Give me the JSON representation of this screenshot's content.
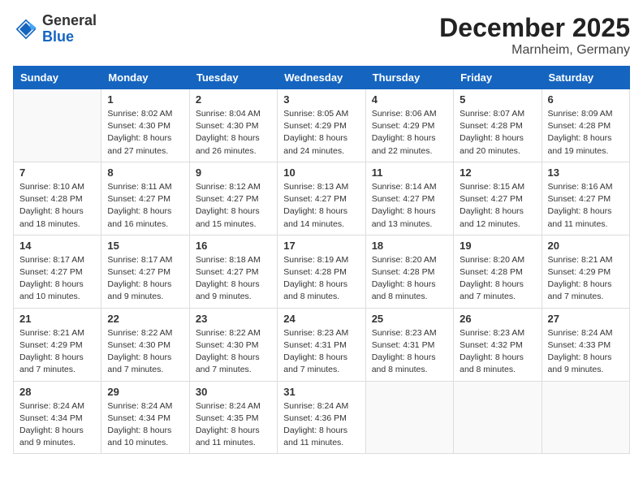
{
  "header": {
    "logo_general": "General",
    "logo_blue": "Blue",
    "month_year": "December 2025",
    "location": "Marnheim, Germany"
  },
  "days_of_week": [
    "Sunday",
    "Monday",
    "Tuesday",
    "Wednesday",
    "Thursday",
    "Friday",
    "Saturday"
  ],
  "weeks": [
    [
      {
        "day": "",
        "info": ""
      },
      {
        "day": "1",
        "info": "Sunrise: 8:02 AM\nSunset: 4:30 PM\nDaylight: 8 hours\nand 27 minutes."
      },
      {
        "day": "2",
        "info": "Sunrise: 8:04 AM\nSunset: 4:30 PM\nDaylight: 8 hours\nand 26 minutes."
      },
      {
        "day": "3",
        "info": "Sunrise: 8:05 AM\nSunset: 4:29 PM\nDaylight: 8 hours\nand 24 minutes."
      },
      {
        "day": "4",
        "info": "Sunrise: 8:06 AM\nSunset: 4:29 PM\nDaylight: 8 hours\nand 22 minutes."
      },
      {
        "day": "5",
        "info": "Sunrise: 8:07 AM\nSunset: 4:28 PM\nDaylight: 8 hours\nand 20 minutes."
      },
      {
        "day": "6",
        "info": "Sunrise: 8:09 AM\nSunset: 4:28 PM\nDaylight: 8 hours\nand 19 minutes."
      }
    ],
    [
      {
        "day": "7",
        "info": "Sunrise: 8:10 AM\nSunset: 4:28 PM\nDaylight: 8 hours\nand 18 minutes."
      },
      {
        "day": "8",
        "info": "Sunrise: 8:11 AM\nSunset: 4:27 PM\nDaylight: 8 hours\nand 16 minutes."
      },
      {
        "day": "9",
        "info": "Sunrise: 8:12 AM\nSunset: 4:27 PM\nDaylight: 8 hours\nand 15 minutes."
      },
      {
        "day": "10",
        "info": "Sunrise: 8:13 AM\nSunset: 4:27 PM\nDaylight: 8 hours\nand 14 minutes."
      },
      {
        "day": "11",
        "info": "Sunrise: 8:14 AM\nSunset: 4:27 PM\nDaylight: 8 hours\nand 13 minutes."
      },
      {
        "day": "12",
        "info": "Sunrise: 8:15 AM\nSunset: 4:27 PM\nDaylight: 8 hours\nand 12 minutes."
      },
      {
        "day": "13",
        "info": "Sunrise: 8:16 AM\nSunset: 4:27 PM\nDaylight: 8 hours\nand 11 minutes."
      }
    ],
    [
      {
        "day": "14",
        "info": "Sunrise: 8:17 AM\nSunset: 4:27 PM\nDaylight: 8 hours\nand 10 minutes."
      },
      {
        "day": "15",
        "info": "Sunrise: 8:17 AM\nSunset: 4:27 PM\nDaylight: 8 hours\nand 9 minutes."
      },
      {
        "day": "16",
        "info": "Sunrise: 8:18 AM\nSunset: 4:27 PM\nDaylight: 8 hours\nand 9 minutes."
      },
      {
        "day": "17",
        "info": "Sunrise: 8:19 AM\nSunset: 4:28 PM\nDaylight: 8 hours\nand 8 minutes."
      },
      {
        "day": "18",
        "info": "Sunrise: 8:20 AM\nSunset: 4:28 PM\nDaylight: 8 hours\nand 8 minutes."
      },
      {
        "day": "19",
        "info": "Sunrise: 8:20 AM\nSunset: 4:28 PM\nDaylight: 8 hours\nand 7 minutes."
      },
      {
        "day": "20",
        "info": "Sunrise: 8:21 AM\nSunset: 4:29 PM\nDaylight: 8 hours\nand 7 minutes."
      }
    ],
    [
      {
        "day": "21",
        "info": "Sunrise: 8:21 AM\nSunset: 4:29 PM\nDaylight: 8 hours\nand 7 minutes."
      },
      {
        "day": "22",
        "info": "Sunrise: 8:22 AM\nSunset: 4:30 PM\nDaylight: 8 hours\nand 7 minutes."
      },
      {
        "day": "23",
        "info": "Sunrise: 8:22 AM\nSunset: 4:30 PM\nDaylight: 8 hours\nand 7 minutes."
      },
      {
        "day": "24",
        "info": "Sunrise: 8:23 AM\nSunset: 4:31 PM\nDaylight: 8 hours\nand 7 minutes."
      },
      {
        "day": "25",
        "info": "Sunrise: 8:23 AM\nSunset: 4:31 PM\nDaylight: 8 hours\nand 8 minutes."
      },
      {
        "day": "26",
        "info": "Sunrise: 8:23 AM\nSunset: 4:32 PM\nDaylight: 8 hours\nand 8 minutes."
      },
      {
        "day": "27",
        "info": "Sunrise: 8:24 AM\nSunset: 4:33 PM\nDaylight: 8 hours\nand 9 minutes."
      }
    ],
    [
      {
        "day": "28",
        "info": "Sunrise: 8:24 AM\nSunset: 4:34 PM\nDaylight: 8 hours\nand 9 minutes."
      },
      {
        "day": "29",
        "info": "Sunrise: 8:24 AM\nSunset: 4:34 PM\nDaylight: 8 hours\nand 10 minutes."
      },
      {
        "day": "30",
        "info": "Sunrise: 8:24 AM\nSunset: 4:35 PM\nDaylight: 8 hours\nand 11 minutes."
      },
      {
        "day": "31",
        "info": "Sunrise: 8:24 AM\nSunset: 4:36 PM\nDaylight: 8 hours\nand 11 minutes."
      },
      {
        "day": "",
        "info": ""
      },
      {
        "day": "",
        "info": ""
      },
      {
        "day": "",
        "info": ""
      }
    ]
  ]
}
